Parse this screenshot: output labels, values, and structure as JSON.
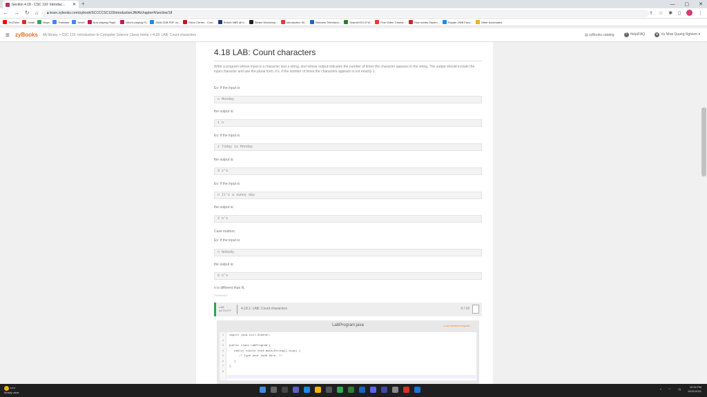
{
  "browser": {
    "tab_title": "Section 4.18 - CSC 110: Introduc...",
    "url": "learn.zybooks.com/zybook/SCCCCSC110IntroductionJAVA/chapter/4/section/18",
    "bookmarks": [
      {
        "label": "YouTube",
        "color": "#ff0000"
      },
      {
        "label": "Gmail",
        "color": "#d93025"
      },
      {
        "label": "Maps",
        "color": "#34a853"
      },
      {
        "label": "Translate",
        "color": "#4285f4"
      },
      {
        "label": "News",
        "color": "#4285f4"
      },
      {
        "label": "Now playing Playli...",
        "color": "#c2185b"
      },
      {
        "label": "Who's playing PL",
        "color": "#c2185b"
      },
      {
        "label": "JAVA ZDB PDF ou...",
        "color": "#1e88e5"
      },
      {
        "label": "Micro Center - Com...",
        "color": "#b71c1c"
      },
      {
        "label": "Refurb NBS all b...",
        "color": "#1e3a8a"
      },
      {
        "label": "Steam Workshop...",
        "color": "#222"
      },
      {
        "label": "Introduction Sk...",
        "color": "#e53935"
      },
      {
        "label": "Discover Television...",
        "color": "#1565c0"
      },
      {
        "label": "Scarnell E/L/3 W...",
        "color": "#2e7d32"
      },
      {
        "label": "Fine Video Tutorial...",
        "color": "#e53935"
      },
      {
        "label": "How scrolls Skyrim...",
        "color": "#c62828"
      },
      {
        "label": "Royale ZWB Favo...",
        "color": "#1e88e5"
      },
      {
        "label": "Other bookmarks",
        "color": "#f9a825"
      }
    ]
  },
  "header": {
    "logo": "zyBooks",
    "breadcrumb": "My library > CSC 110: Introduction to Computer Science (Java) home > 4.18: LAB: Count characters",
    "catalog": "zyBooks catalog",
    "help": "Help/FAQ",
    "user": "Vu Nhat Quang Nghiem"
  },
  "content": {
    "title": "4.18 LAB: Count characters",
    "intro": "Write a program whose input is a character and a string, and whose output indicates the number of times the character appears in the string. The output should include the input character and use the plural form, n's, if the number of times the characters appears is not exactly 1.",
    "examples": [
      {
        "input_label": "Ex: If the input is:",
        "input": "n Monday",
        "output_label": "the output is:",
        "output": "1 n"
      },
      {
        "input_label": "Ex: If the input is:",
        "input": "z Today is Monday",
        "output_label": "the output is:",
        "output": "0 z's"
      },
      {
        "input_label": "Ex: If the input is:",
        "input": "n It's a sunny day",
        "output_label": "the output is:",
        "output": "2 n's"
      }
    ],
    "case_matters": "Case matters.",
    "example4": {
      "input_label": "Ex: If the input is:",
      "input": "n Nobody",
      "output_label": "the output is:",
      "output": "0 n's"
    },
    "note": "n is different than N.",
    "feedback": "Feedback?"
  },
  "lab": {
    "tag": "LAB ACTIVITY",
    "name": "4.18.1: LAB: Count characters",
    "score": "0 / 10",
    "filename": "LabProgram.java",
    "reset": "Load default template...",
    "lines": [
      {
        "n": "1",
        "code": "import java.util.Scanner;"
      },
      {
        "n": "2",
        "code": ""
      },
      {
        "n": "3",
        "code": "public class LabProgram {"
      },
      {
        "n": "4",
        "code": "   public static void main(String[] args) {"
      },
      {
        "n": "5",
        "code": "      /* Type your code here. */"
      },
      {
        "n": "6",
        "code": "   }"
      },
      {
        "n": "7",
        "code": "}"
      },
      {
        "n": "8",
        "code": ""
      }
    ]
  },
  "taskbar": {
    "weather_temp": "74°F",
    "weather_desc": "Mostly clear",
    "time": "10:32 PM",
    "date": "10/21/2021"
  }
}
